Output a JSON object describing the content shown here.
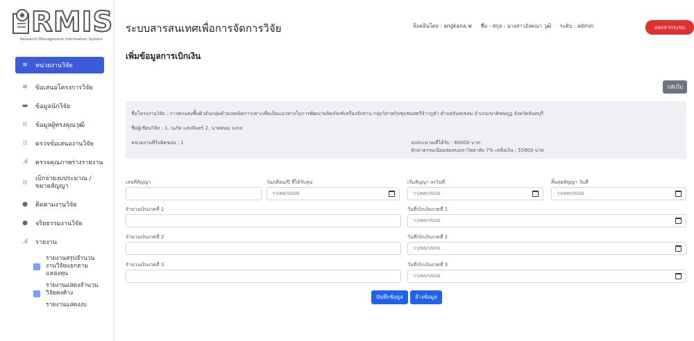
{
  "logo": {
    "text": "RMIS",
    "subtitle": "Research Management Information System"
  },
  "header": {
    "title": "ระบบสารสนเทศเพื่อการจัดการวิจัย",
    "login_label": "ล็อคอินโดย : angkana.w",
    "name_label": "ชื่อ - สกุล : นางสาวอังคณา วุฒิ",
    "level_label": "ระดับ : admin",
    "logout_label": "ออกจากระบบ"
  },
  "sidebar": {
    "items": [
      {
        "label": "หน่วยงานวิจัย",
        "icon": "layers-icon",
        "active": true
      },
      {
        "label": "ข้อเสนอโครงการวิจัย",
        "icon": "layers-icon"
      },
      {
        "label": "ข้อมูลนักวิจัย",
        "icon": "inbox-icon"
      },
      {
        "label": "ข้อมูลผู้ทรงคุณวุฒิ",
        "icon": "grid-icon"
      },
      {
        "label": "ตรวจข้อเสนองานวิจัย",
        "icon": "grid-icon"
      },
      {
        "label": "ตรวจคุณภาพร่างรายงาน",
        "icon": "bar-chart-icon"
      },
      {
        "label": "เบิกจ่ายงบประมาณ / ขยายสัญญา",
        "icon": "grid-icon"
      },
      {
        "label": "ติดตามงานวิจัย",
        "icon": "circle-icon"
      },
      {
        "label": "จริยธรรมงานวิจัย",
        "icon": "drop-icon"
      },
      {
        "label": "รายงาน",
        "icon": "bar-chart-icon"
      }
    ],
    "sub_items": [
      {
        "label": "รายงานสรุปจำนวนงานวิจัยแยกตามแหล่งทุน"
      },
      {
        "label": "รายงานแสดงจำนวนวิจัยคงค้าง"
      },
      {
        "label": "รายงานแสดงงบ"
      }
    ]
  },
  "page": {
    "title": "เพิ่มข้อมูลการเบิกเงิน",
    "back_label": "กลับไป"
  },
  "info": {
    "project": "ชื่อโครงงานวิจัย : การตกแต่งพื้นผิวด้นกลุ่มด้วยเทคนิคการเพาะเพื่อเป็นแนวทางในการพัฒนาผลิตภัณฑ์เครื่องจักสาน กลุ่มวิสาหกิจชุมชนสตรีจ้าวกูฬา ตำบลจันทเขลม อำเภอเขาคิชฌกูฏ จังหวัดจันทบุรี",
    "researchers": "ชื่อผู้เขียนวิจัย : 1. ณภัค แสงจันทร์   2. นายพนม จงกล",
    "unit": "หน่วยงานที่รับผิดชอบ : 1",
    "budget": "งบประมาณที่ได้รับ : 60000 บาท",
    "fee": "หักค่าธรรมเนียมสมทบมหาวิทยาลัย 7% เหลือเงิน : 55800 บาท"
  },
  "form": {
    "contract_no_label": "เลขที่สัญญา",
    "date_received_label": "วัน/เดือน/ปี ที่ได้รับทุน",
    "start_label": "เริ่มสัญญา ลงวันที่",
    "end_label": "สิ้นสุดสัญญา วันที่",
    "date_placeholder": "วว/ดด/ปปปป",
    "amount1_label": "จำนวนเงินงวดที่ 1",
    "date1_label": "วันที่เบิกเงินงวดที่ 1",
    "amount2_label": "จำนวนเงินงวดที่ 2",
    "date2_label": "วันที่เบิกเงินงวดที่ 2",
    "amount3_label": "จำนวนเงินงวดที่ 3",
    "date3_label": "วันที่เบิกเงินงวดที่ 3",
    "save_label": "บันทึกข้อมูล",
    "clear_label": "ล้างข้อมูล"
  },
  "colors": {
    "primary": "#1d63ed",
    "sidebar_active": "#3b5bdb",
    "logout": "#e03131",
    "back": "#6c757d"
  }
}
